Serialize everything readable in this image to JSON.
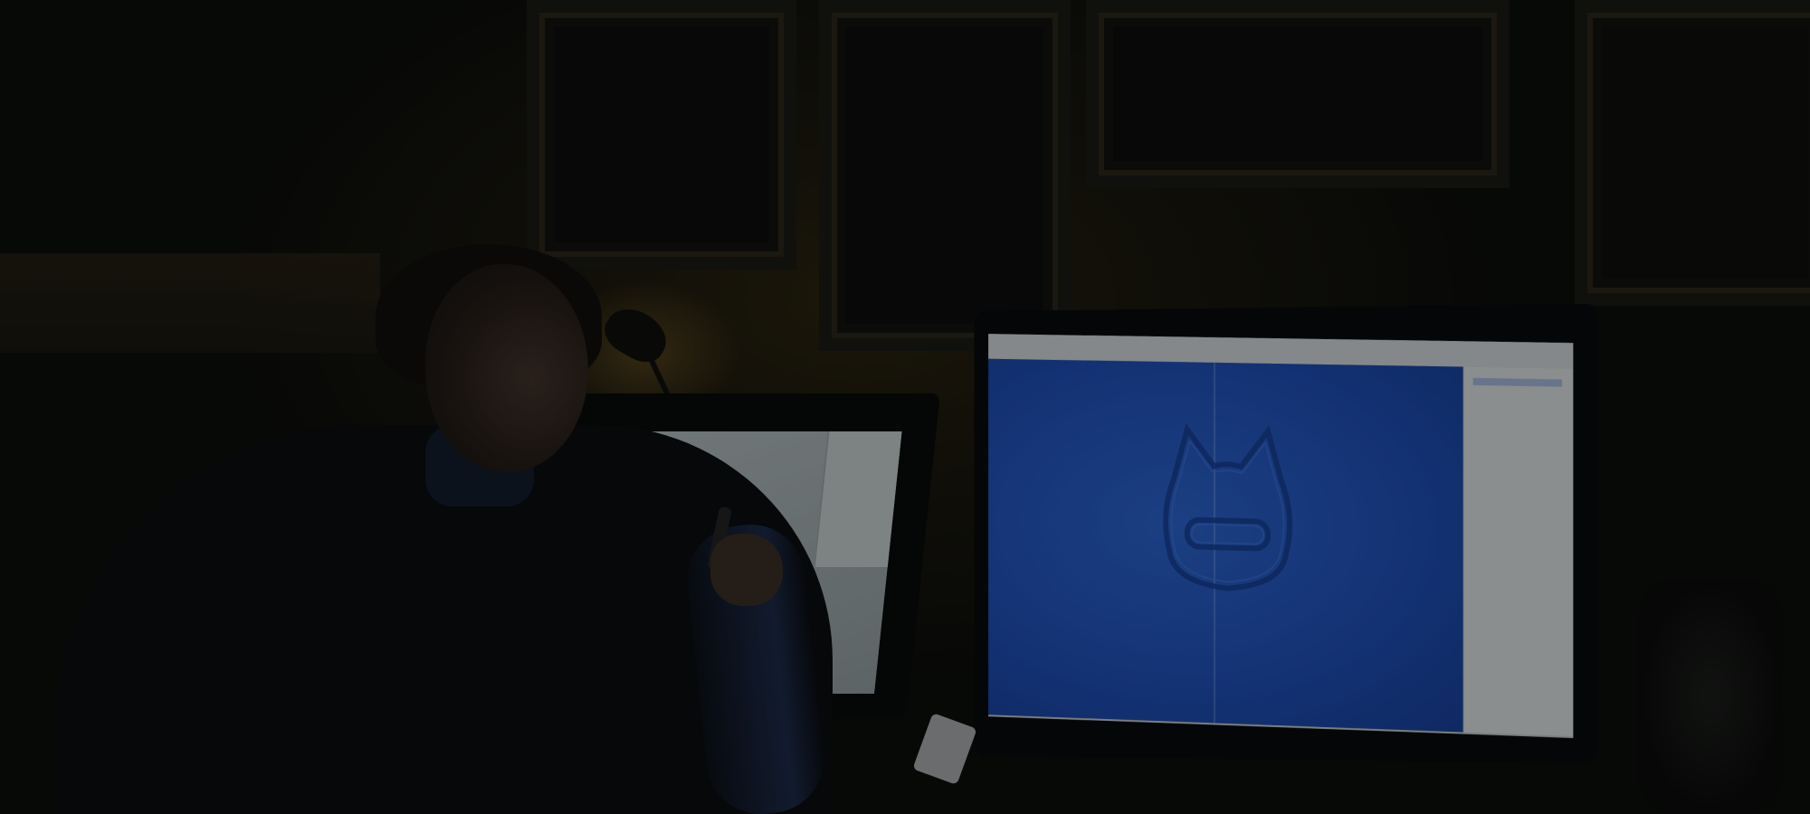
{
  "scene": {
    "description_tags": [
      "designer",
      "cintiq-tablet",
      "monitor",
      "dim-room"
    ],
    "colors": {
      "canvas_blue": "#1f4fb4",
      "wall": "#1a170d",
      "screen_ui": "#bfc4c6"
    },
    "icons": {
      "mascot": "cat-face-outline-icon",
      "lamp": "desk-lamp-icon",
      "speaker": "speaker-icon",
      "stylus": "stylus-pen-icon"
    }
  }
}
